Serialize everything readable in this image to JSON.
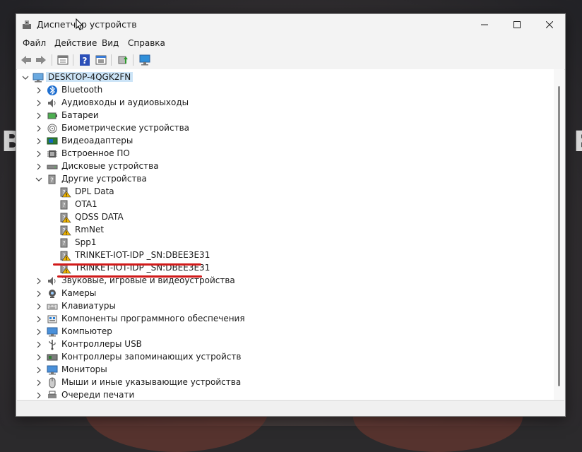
{
  "window": {
    "title": "Диспетчер устройств",
    "menu": [
      "Файл",
      "Действие",
      "Вид",
      "Справка"
    ]
  },
  "background": {
    "left_text": "B",
    "right_text": "E"
  },
  "tree": {
    "root": "DESKTOP-4QGK2FN",
    "categories": [
      {
        "label": "Bluetooth",
        "icon": "bluetooth-icon",
        "expanded": false
      },
      {
        "label": "Аудиовходы и аудиовыходы",
        "icon": "speaker-icon",
        "expanded": false
      },
      {
        "label": "Батареи",
        "icon": "battery-icon",
        "expanded": false
      },
      {
        "label": "Биометрические устройства",
        "icon": "fingerprint-icon",
        "expanded": false
      },
      {
        "label": "Видеоадаптеры",
        "icon": "display-adapter-icon",
        "expanded": false
      },
      {
        "label": "Встроенное ПО",
        "icon": "firmware-icon",
        "expanded": false
      },
      {
        "label": "Дисковые устройства",
        "icon": "disk-drive-icon",
        "expanded": false
      },
      {
        "label": "Другие устройства",
        "icon": "unknown-device-icon",
        "expanded": true
      }
    ],
    "other_devices": [
      {
        "label": "DPL Data",
        "warning": true
      },
      {
        "label": "OTA1",
        "warning": false
      },
      {
        "label": "QDSS DATA",
        "warning": true
      },
      {
        "label": "RmNet",
        "warning": true
      },
      {
        "label": "Spp1",
        "warning": false
      },
      {
        "label": "TRINKET-IOT-IDP _SN:DBEE3E31",
        "warning": true,
        "highlighted": true
      },
      {
        "label": "TRINKET-IOT-IDP _SN:DBEE3E31",
        "warning": true,
        "highlighted": true
      }
    ],
    "categories_after": [
      {
        "label": "Звуковые, игровые и видеоустройства",
        "icon": "sound-icon"
      },
      {
        "label": "Камеры",
        "icon": "camera-icon"
      },
      {
        "label": "Клавиатуры",
        "icon": "keyboard-icon"
      },
      {
        "label": "Компоненты программного обеспечения",
        "icon": "software-component-icon"
      },
      {
        "label": "Компьютер",
        "icon": "computer-icon"
      },
      {
        "label": "Контроллеры USB",
        "icon": "usb-icon"
      },
      {
        "label": "Контроллеры запоминающих устройств",
        "icon": "storage-controller-icon"
      },
      {
        "label": "Мониторы",
        "icon": "monitor-icon"
      },
      {
        "label": "Мыши и иные указывающие устройства",
        "icon": "mouse-icon"
      },
      {
        "label": "Очереди печати",
        "icon": "printer-icon"
      }
    ]
  },
  "colors": {
    "selection": "#cce4f7",
    "highlight_line": "#d11a1a",
    "warning": "#f2b600"
  }
}
